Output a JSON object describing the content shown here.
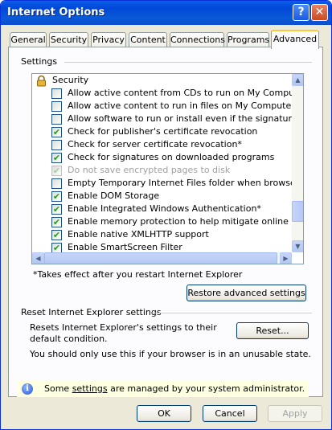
{
  "window": {
    "title": "Internet Options",
    "help_glyph": "?",
    "close_glyph": "✕"
  },
  "tabs": [
    {
      "label": "General"
    },
    {
      "label": "Security"
    },
    {
      "label": "Privacy"
    },
    {
      "label": "Content"
    },
    {
      "label": "Connections"
    },
    {
      "label": "Programs"
    },
    {
      "label": "Advanced",
      "active": true
    }
  ],
  "settings": {
    "group_label": "Settings",
    "section_heading": "Security",
    "items": [
      {
        "label": "Allow active content from CDs to run on My Computer*",
        "checked": false,
        "enabled": true
      },
      {
        "label": "Allow active content to run in files on My Computer*",
        "checked": false,
        "enabled": true
      },
      {
        "label": "Allow software to run or install even if the signature is inva",
        "checked": false,
        "enabled": true
      },
      {
        "label": "Check for publisher's certificate revocation",
        "checked": true,
        "enabled": true
      },
      {
        "label": "Check for server certificate revocation*",
        "checked": false,
        "enabled": true
      },
      {
        "label": "Check for signatures on downloaded programs",
        "checked": true,
        "enabled": true
      },
      {
        "label": "Do not save encrypted pages to disk",
        "checked": true,
        "enabled": false
      },
      {
        "label": "Empty Temporary Internet Files folder when browser is clo",
        "checked": false,
        "enabled": true
      },
      {
        "label": "Enable DOM Storage",
        "checked": true,
        "enabled": true
      },
      {
        "label": "Enable Integrated Windows Authentication*",
        "checked": true,
        "enabled": true
      },
      {
        "label": "Enable memory protection to help mitigate online attacks*",
        "checked": true,
        "enabled": true
      },
      {
        "label": "Enable native XMLHTTP support",
        "checked": true,
        "enabled": true
      },
      {
        "label": "Enable SmartScreen Filter",
        "checked": true,
        "enabled": true
      }
    ],
    "check_glyph": "✔",
    "scroll_up_glyph": "▲",
    "scroll_down_glyph": "▼",
    "scroll_left_glyph": "◀",
    "scroll_right_glyph": "▶"
  },
  "restart_note": "*Takes effect after you restart Internet Explorer",
  "restore_button": "Restore advanced settings",
  "reset_section": {
    "title": "Reset Internet Explorer settings",
    "description": "Resets Internet Explorer's settings to their default condition.",
    "button": "Reset...",
    "warning": "You should only use this if your browser is in an unusable state."
  },
  "infobar": {
    "icon_glyph": "i",
    "text_before": "Some ",
    "link": "settings",
    "text_after": " are managed by your system administrator."
  },
  "footer": {
    "ok": "OK",
    "cancel": "Cancel",
    "apply": "Apply"
  }
}
